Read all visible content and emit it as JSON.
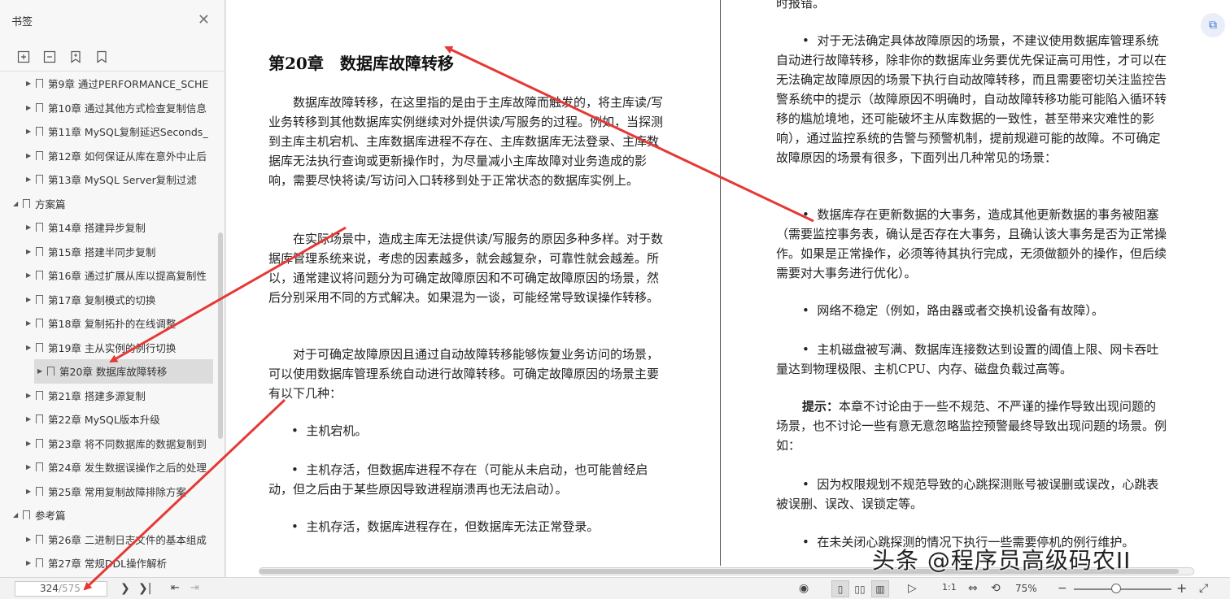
{
  "sidebar": {
    "title": "书签",
    "items": [
      {
        "level": 2,
        "label": "第9章 通过PERFORMANCE_SCHE",
        "active": false
      },
      {
        "level": 2,
        "label": "第10章 通过其他方式检查复制信息",
        "active": false
      },
      {
        "level": 2,
        "label": "第11章 MySQL复制延迟Seconds_",
        "active": false
      },
      {
        "level": 2,
        "label": "第12章 如何保证从库在意外中止后",
        "active": false
      },
      {
        "level": 2,
        "label": "第13章 MySQL Server复制过滤",
        "active": false
      },
      {
        "level": 1,
        "label": "方案篇",
        "active": false
      },
      {
        "level": 2,
        "label": "第14章 搭建异步复制",
        "active": false
      },
      {
        "level": 2,
        "label": "第15章 搭建半同步复制",
        "active": false
      },
      {
        "level": 2,
        "label": "第16章 通过扩展从库以提高复制性",
        "active": false
      },
      {
        "level": 2,
        "label": "第17章 复制模式的切换",
        "active": false
      },
      {
        "level": 2,
        "label": "第18章 复制拓扑的在线调整",
        "active": false
      },
      {
        "level": 2,
        "label": "第19章 主从实例的例行切换",
        "active": false
      },
      {
        "level": 2,
        "label": "第20章 数据库故障转移",
        "active": true
      },
      {
        "level": 2,
        "label": "第21章 搭建多源复制",
        "active": false
      },
      {
        "level": 2,
        "label": "第22章 MySQL版本升级",
        "active": false
      },
      {
        "level": 2,
        "label": "第23章 将不同数据库的数据复制到",
        "active": false
      },
      {
        "level": 2,
        "label": "第24章 发生数据误操作之后的处理",
        "active": false
      },
      {
        "level": 2,
        "label": "第25章 常用复制故障排除方案",
        "active": false
      },
      {
        "level": 1,
        "label": "参考篇",
        "active": false
      },
      {
        "level": 2,
        "label": "第26章 二进制日志文件的基本组成",
        "active": false
      },
      {
        "level": 2,
        "label": "第27章 常规DDL操作解析",
        "active": false
      }
    ]
  },
  "doc": {
    "chapter_title": "第20章　数据库故障转移",
    "left": [
      {
        "type": "indent",
        "text": "数据库故障转移，在这里指的是由于主库故障而触发的，将主库读/写业务转移到其他数据库实例继续对外提供读/写服务的过程。例如，当探测到主库主机宕机、主库数据库进程不存在、主库数据库无法登录、主库数据库无法执行查询或更新操作时，为尽量减小主库故障对业务造成的影响，需要尽快将读/写访问入口转移到处于正常状态的数据库实例上。"
      },
      {
        "type": "indent",
        "text": "在实际场景中，造成主库无法提供读/写服务的原因多种多样。对于数据库管理系统来说，考虑的因素越多，就会越复杂，可靠性就会越差。所以，通常建议将问题分为可确定故障原因和不可确定故障原因的场景，然后分别采用不同的方式解决。如果混为一谈，可能经常导致误操作转移。"
      },
      {
        "type": "indent",
        "text": "对于可确定故障原因且通过自动故障转移能够恢复业务访问的场景，可以使用数据库管理系统自动进行故障转移。可确定故障原因的场景主要有以下几种："
      },
      {
        "type": "bullet",
        "text": "主机宕机。"
      },
      {
        "type": "bullet",
        "text": "主机存活，但数据库进程不存在（可能从未启动，也可能曾经启动，但之后由于某些原因导致进程崩溃再也无法启动）。"
      },
      {
        "type": "bullet",
        "text": "主机存活，数据库进程存在，但数据库无法正常登录。"
      }
    ],
    "right_top": "时报错。",
    "right": [
      {
        "type": "bullet",
        "text": "对于无法确定具体故障原因的场景，不建议使用数据库管理系统自动进行故障转移，除非你的数据库业务要优先保证高可用性，才可以在无法确定故障原因的场景下执行自动故障转移，而且需要密切关注监控告警系统中的提示（故障原因不明确时，自动故障转移功能可能陷入循环转移的尴尬境地，还可能破坏主从库数据的一致性，甚至带来灾难性的影响），通过监控系统的告警与预警机制，提前规避可能的故障。不可确定故障原因的场景有很多，下面列出几种常见的场景："
      },
      {
        "type": "bullet",
        "text": "数据库存在更新数据的大事务，造成其他更新数据的事务被阻塞（需要监控事务表，确认是否存在大事务，且确认该大事务是否为正常操作。如果是正常操作，必须等待其执行完成，无须做额外的操作，但后续需要对大事务进行优化）。"
      },
      {
        "type": "bullet",
        "text": "网络不稳定（例如，路由器或者交换机设备有故障）。"
      },
      {
        "type": "bullet",
        "text": "主机磁盘被写满、数据库连接数达到设置的阈值上限、网卡吞吐量达到物理极限、主机CPU、内存、磁盘负载过高等。"
      },
      {
        "type": "tip",
        "label": "提示：",
        "text": "本章不讨论由于一些不规范、不严谨的操作导致出现问题的场景，也不讨论一些有意无意忽略监控预警最终导致出现问题的场景。例如："
      },
      {
        "type": "bullet",
        "text": "因为权限规划不规范导致的心跳探测账号被误删或误改，心跳表被误删、误改、误锁定等。"
      },
      {
        "type": "bullet",
        "text": "在未关闭心跳探测的情况下执行一些需要停机的例行维护。"
      }
    ]
  },
  "statusbar": {
    "current_page": "324",
    "total_pages": "/575",
    "zoom": "75%"
  },
  "watermark": "头条 @程序员高级码农II"
}
